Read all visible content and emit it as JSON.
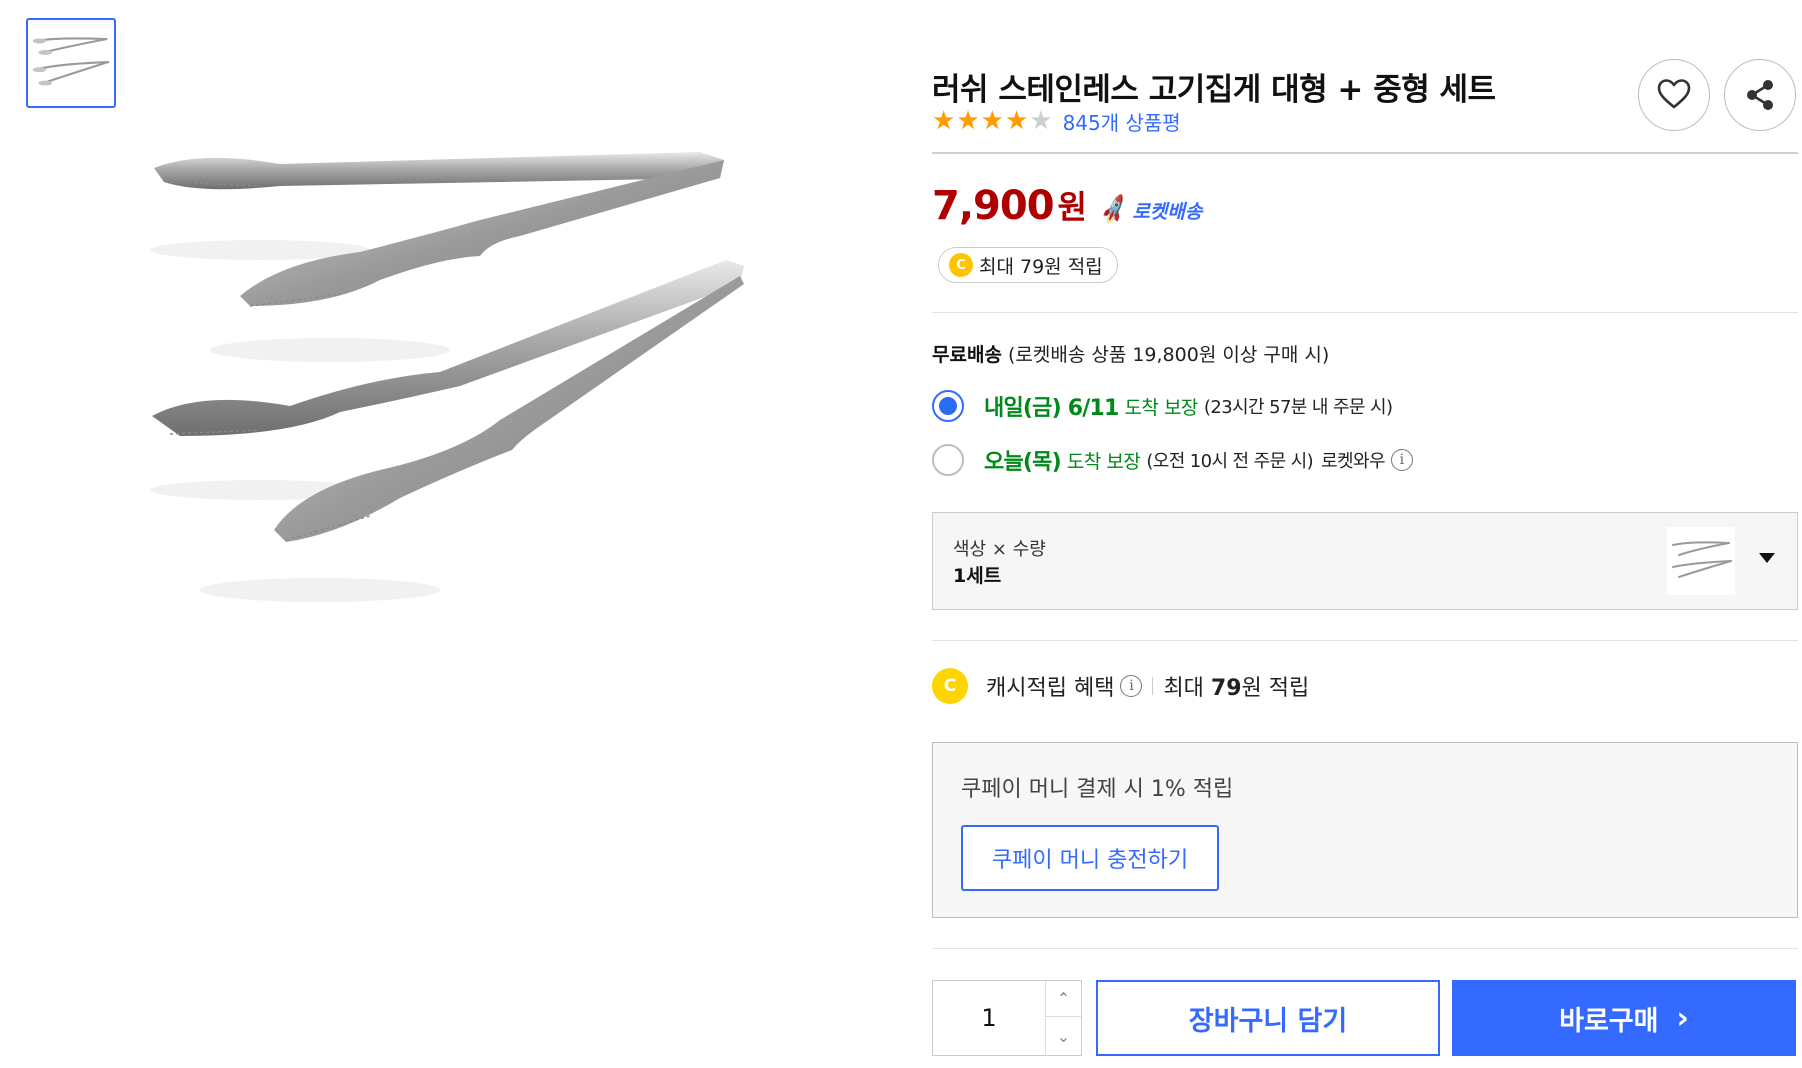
{
  "product": {
    "title": "러쉬 스테인레스 고기집게 대형 + 중형 세트",
    "rating": 4,
    "rating_max": 5,
    "review_count_label": "845개 상품평",
    "image_alt": "stainless tongs large and medium"
  },
  "actions": {
    "favorite_icon": "heart-icon",
    "share_icon": "share-icon"
  },
  "price": {
    "amount": "7,900",
    "unit": "원",
    "badge_icon": "rocket-icon",
    "badge_label": "로켓배송",
    "cash_label": "최대 79원 적립",
    "cash_icon_letter": "C"
  },
  "shipping": {
    "title": "무료배송",
    "condition": "(로켓배송 상품 19,800원 이상 구매 시)",
    "options": [
      {
        "selected": true,
        "date": "내일(금) 6/11",
        "guarantee": "도착 보장",
        "note": "(23시간 57분 내 주문 시)",
        "extra": ""
      },
      {
        "selected": false,
        "date": "오늘(목)",
        "guarantee": "도착 보장",
        "note": "(오전 10시 전 주문 시)",
        "extra": "로켓와우"
      }
    ]
  },
  "option_selector": {
    "label": "색상 × 수량",
    "value": "1세트"
  },
  "cash_benefit": {
    "icon_letter": "C",
    "title": "캐시적립 혜택",
    "prefix": "최대 ",
    "amount": "79",
    "suffix": "원 적립"
  },
  "coupay": {
    "text": "쿠페이 머니 결제 시 1% 적립",
    "button_label": "쿠페이 머니 충전하기"
  },
  "purchase": {
    "quantity": "1",
    "cart_label": "장바구니 담기",
    "buy_label": "바로구매",
    "buy_chevron": "›"
  },
  "colors": {
    "accent": "#346aff",
    "price": "#ae0000",
    "delivery_green": "#00891a",
    "star": "#ff9b00",
    "cash_coin": "#ffc400"
  }
}
